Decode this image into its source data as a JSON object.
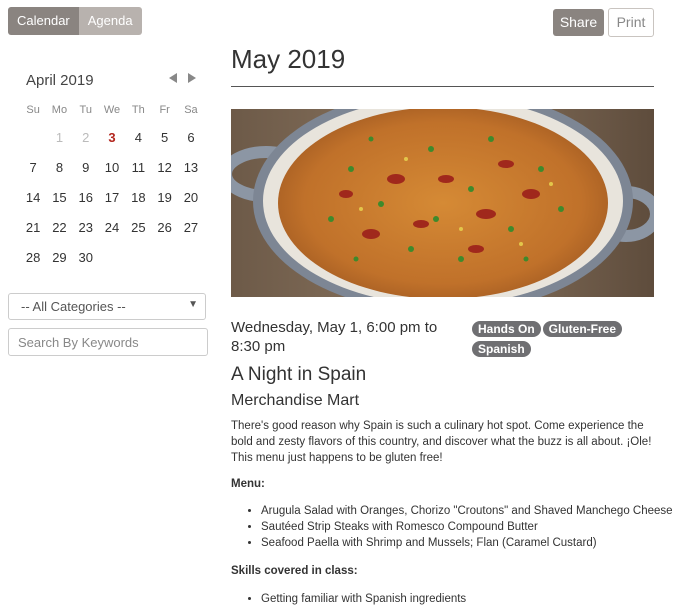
{
  "toolbar": {
    "calendar_label": "Calendar",
    "agenda_label": "Agenda",
    "share_label": "Share",
    "print_label": "Print"
  },
  "mini_calendar": {
    "month_label": "April 2019",
    "prev_icon": "triangle-left-icon",
    "next_icon": "triangle-right-icon",
    "weekdays": [
      "Su",
      "Mo",
      "Tu",
      "We",
      "Th",
      "Fr",
      "Sa"
    ],
    "weeks": [
      [
        "",
        "1",
        "2",
        "3",
        "4",
        "5",
        "6"
      ],
      [
        "7",
        "8",
        "9",
        "10",
        "11",
        "12",
        "13"
      ],
      [
        "14",
        "15",
        "16",
        "17",
        "18",
        "19",
        "20"
      ],
      [
        "21",
        "22",
        "23",
        "24",
        "25",
        "26",
        "27"
      ],
      [
        "28",
        "29",
        "30",
        "",
        "",
        "",
        ""
      ]
    ],
    "muted_days": [
      "1",
      "2"
    ],
    "today": "3",
    "today_color": "#b3261e"
  },
  "filters": {
    "category_selected": "-- All Categories --",
    "keyword_placeholder": "Search By Keywords"
  },
  "main": {
    "title": "May 2019",
    "event": {
      "when": "Wednesday, May 1, 6:00 pm to 8:30 pm",
      "tags": [
        "Hands On",
        "Gluten-Free",
        "Spanish"
      ],
      "title": "A Night in Spain",
      "venue": "Merchandise Mart",
      "description": "There's good reason why Spain is such a culinary hot spot. Come experience the bold and zesty flavors of this country, and discover what the buzz is all about. ¡Ole! This menu just happens to be gluten free!",
      "menu_label": "Menu:",
      "menu_items": [
        "Arugula Salad with Oranges, Chorizo \"Croutons\" and Shaved Manchego Cheese",
        "Sautéed Strip Steaks with Romesco Compound Butter",
        "Seafood Paella with Shrimp and Mussels; Flan (Caramel Custard)"
      ],
      "skills_label": "Skills covered in class:",
      "skills_items": [
        "Getting familiar with Spanish ingredients"
      ]
    }
  },
  "colors": {
    "button_active": "#8a8480",
    "button_inactive": "#b8b2ae",
    "tag_bg": "#6f6f72"
  }
}
